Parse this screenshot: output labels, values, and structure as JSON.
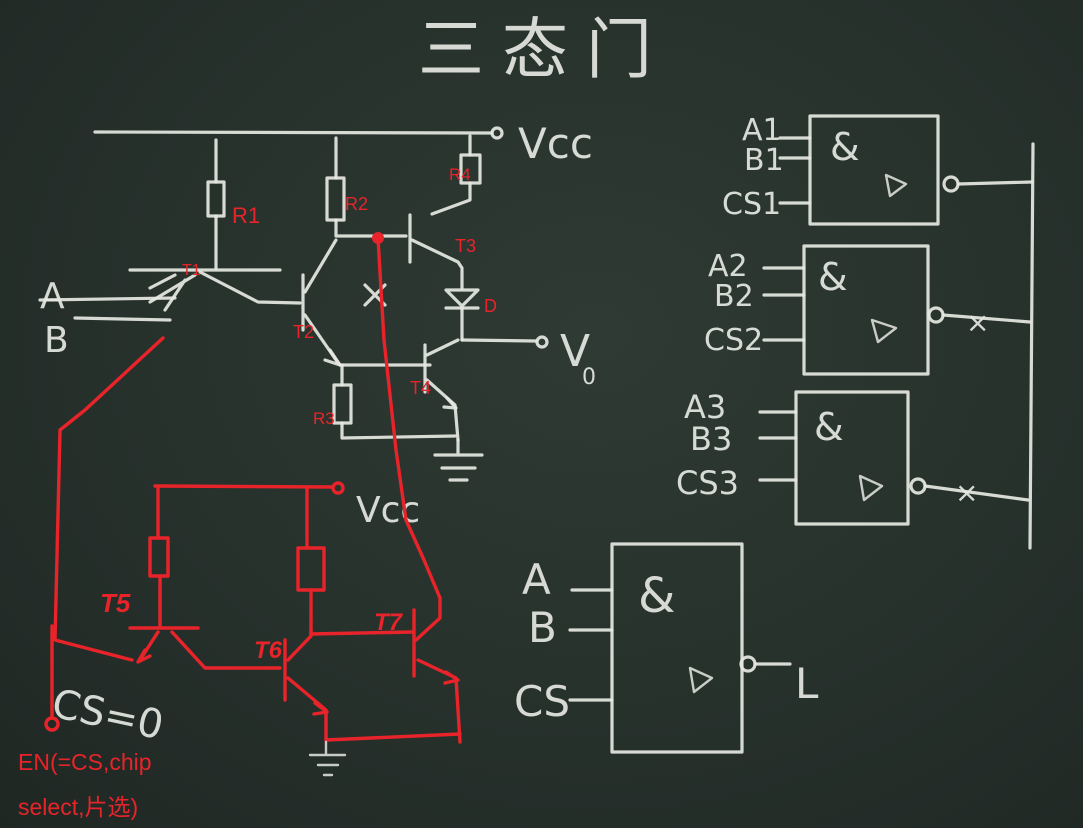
{
  "title": "三态门",
  "labels": {
    "vcc_top": "Vcc",
    "vcc_bottom": "Vcc",
    "vo": "V",
    "vo_sub": "0",
    "input_a": "A",
    "input_b": "B",
    "cs_eq": "CS=0",
    "r1": "R1",
    "r2": "R2",
    "r3": "R3",
    "r4": "R4",
    "t1": "T1",
    "t2": "T2",
    "t3": "T3",
    "t4": "T4",
    "d": "D",
    "t5": "T5",
    "t6": "T6",
    "t7": "T7",
    "en_line1": "EN(=CS,chip",
    "en_line2": "select,片选)"
  },
  "gates": [
    {
      "in1": "A1",
      "in2": "B1",
      "cs": "CS1",
      "amp": "&",
      "out_mark": ""
    },
    {
      "in1": "A2",
      "in2": "B2",
      "cs": "CS2",
      "amp": "&",
      "out_mark": "×"
    },
    {
      "in1": "A3",
      "in2": "B3",
      "cs": "CS3",
      "amp": "&",
      "out_mark": "×"
    }
  ],
  "big_gate": {
    "in1": "A",
    "in2": "B",
    "cs": "CS",
    "amp": "&",
    "out": "L"
  },
  "colors": {
    "board": "#27312c",
    "chalk": "#e6e9e3",
    "red": "#e8242a"
  }
}
